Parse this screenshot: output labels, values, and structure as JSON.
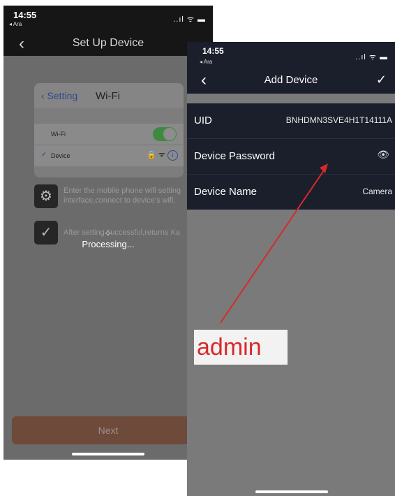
{
  "left_phone": {
    "status": {
      "time": "14:55",
      "back_app": "◂ Ara",
      "signal": "..ıl ᯤ ▬"
    },
    "nav": {
      "back": "‹",
      "title": "Set Up Device"
    },
    "wifi_card": {
      "back_label": "‹ Setting",
      "title": "Wi-Fi",
      "wifi_row_label": "Wi-Fi",
      "device_check": "✓",
      "device_row_label": "Device",
      "device_row_icons": "🔒 ᯤ",
      "info_icon": "i"
    },
    "steps": [
      {
        "icon": "⚙",
        "text": "Enter the mobile phone wifi setting interface,connect to device's wifi."
      },
      {
        "icon": "✓",
        "text": "After setting successful,returns Ka"
      }
    ],
    "spinner": "⁘",
    "processing": "Processing...",
    "next_button": "Next"
  },
  "right_phone": {
    "status": {
      "time": "14:55",
      "back_app": "◂ Ara",
      "signal": "..ıl ᯤ ▬"
    },
    "nav": {
      "back": "‹",
      "title": "Add Device",
      "confirm": "✓"
    },
    "form": [
      {
        "label": "UID",
        "value": "BNHDMN3SVE4H1T14111A"
      },
      {
        "label": "Device Password",
        "value": ""
      },
      {
        "label": "Device Name",
        "value": "Camera"
      }
    ],
    "eye_icon": "👁"
  },
  "annotation": {
    "text": "admin",
    "color": "#d62a2a"
  }
}
